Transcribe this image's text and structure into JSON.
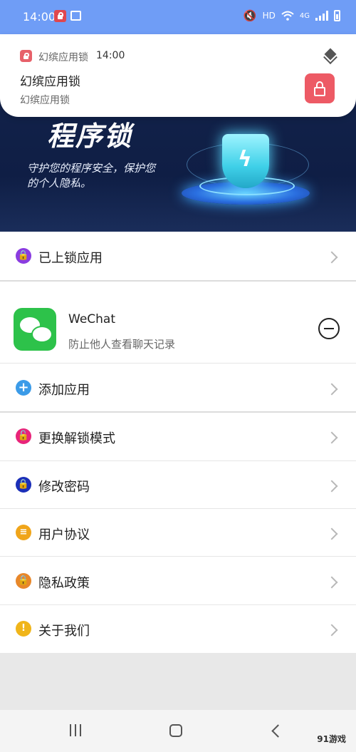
{
  "status_bar": {
    "time": "14:00",
    "indicators": [
      "HD",
      "4G"
    ],
    "icons": [
      "app-lock-icon",
      "image-icon",
      "mute-icon",
      "wifi-icon",
      "signal-icon",
      "battery-icon"
    ]
  },
  "notification": {
    "app_name": "幻缤应用锁",
    "time": "14:00",
    "title": "幻缤应用锁",
    "text": "幻缤应用锁",
    "icons": [
      "app-lock-icon",
      "layers-icon",
      "lock-icon"
    ]
  },
  "banner": {
    "title": "程序锁",
    "subtitle": "守护您的程序安全，保护您的个人隐私。"
  },
  "locked_apps_row": {
    "label": "已上锁应用",
    "icon_color": "#8a3ce0"
  },
  "locked_app": {
    "name": "WeChat",
    "description": "防止他人查看聊天记录",
    "icon_color": "#2dc24a"
  },
  "add_app_row": {
    "label": "添加应用",
    "icon_color": "#3b9be8"
  },
  "menu": [
    {
      "label": "更换解锁模式",
      "icon": "unlock-icon",
      "color": "#e8247a"
    },
    {
      "label": "修改密码",
      "icon": "password-lock-icon",
      "color": "#1b2fb8"
    },
    {
      "label": "用户协议",
      "icon": "document-icon",
      "color": "#f0a51a"
    },
    {
      "label": "隐私政策",
      "icon": "privacy-lock-icon",
      "color": "#e8872a"
    },
    {
      "label": "关于我们",
      "icon": "info-exclamation-icon",
      "color": "#f0b51a"
    }
  ],
  "watermark": "91游戏",
  "nav": {
    "icons": [
      "recents-icon",
      "home-icon",
      "back-icon"
    ]
  }
}
